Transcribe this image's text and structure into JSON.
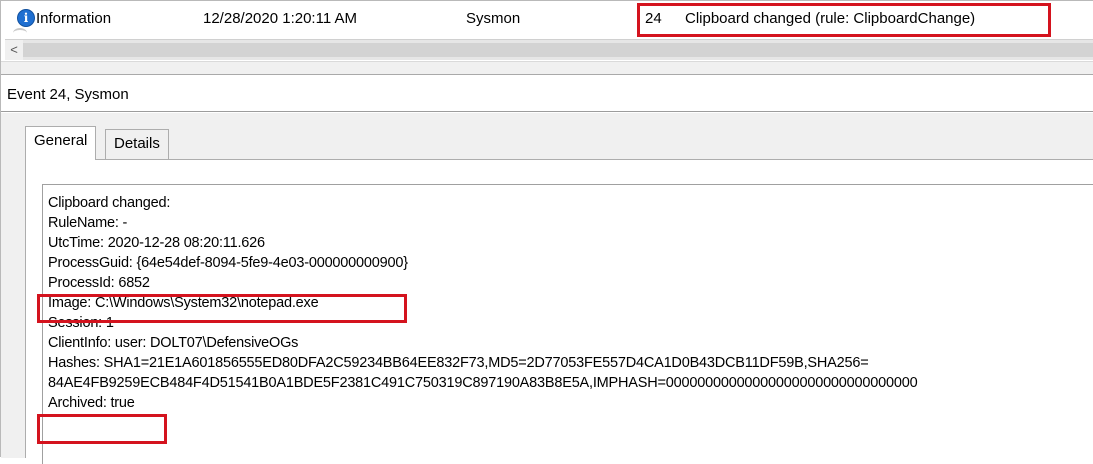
{
  "event_row": {
    "level": "Information",
    "date_time": "12/28/2020 1:20:11 AM",
    "source": "Sysmon",
    "event_id": "24",
    "task_category": "Clipboard changed (rule: ClipboardChange)"
  },
  "scrollbar": {
    "left_arrow": "<"
  },
  "details": {
    "header_title": "Event 24, Sysmon",
    "tabs": [
      {
        "label": "General",
        "selected": true
      },
      {
        "label": "Details",
        "selected": false
      }
    ],
    "message_lines": [
      "Clipboard changed:",
      "RuleName: -",
      "UtcTime: 2020-12-28 08:20:11.626",
      "ProcessGuid: {64e54def-8094-5fe9-4e03-000000000900}",
      "ProcessId: 6852",
      "Image: C:\\Windows\\System32\\notepad.exe",
      "Session: 1",
      "ClientInfo: user: DOLT07\\DefensiveOGs",
      "Hashes: SHA1=21E1A601856555ED80DFA2C59234BB64EE832F73,MD5=2D77053FE557D4CA1D0B43DCB11DF59B,SHA256=",
      "84AE4FB9259ECB484F4D51541B0A1BDE5F2381C491C750319C897190A83B8E5A,IMPHASH=00000000000000000000000000000000",
      "Archived: true"
    ]
  },
  "colors": {
    "highlight": "#d4131e",
    "info_icon": "#1f6fd1"
  },
  "icons": {
    "level_icon": "info-icon"
  }
}
